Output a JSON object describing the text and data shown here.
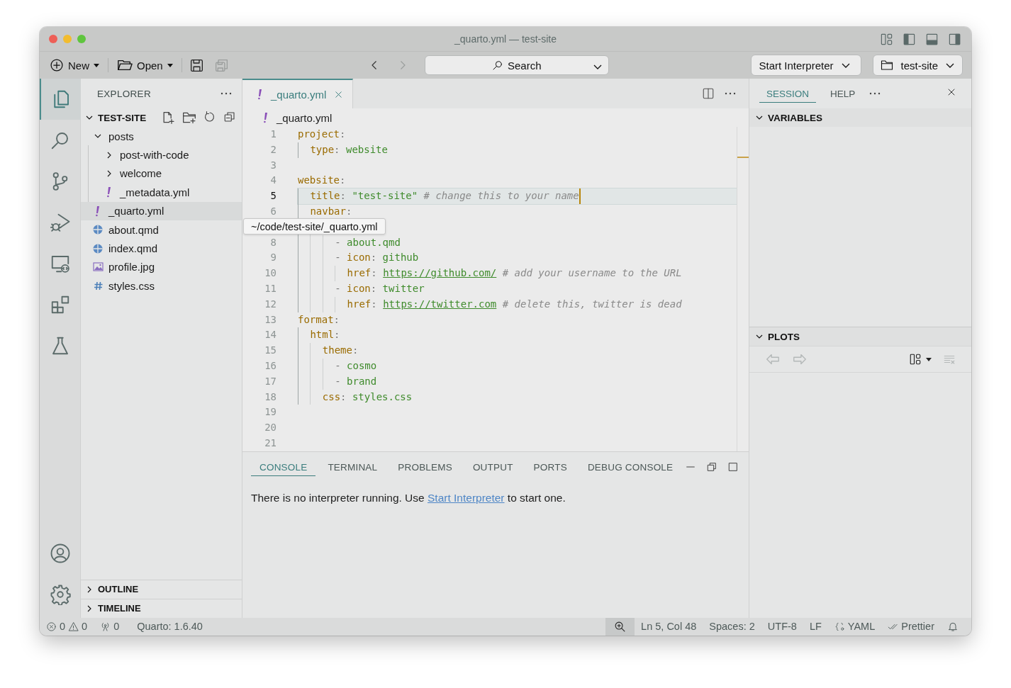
{
  "window": {
    "title": "_quarto.yml — test-site"
  },
  "toolbar": {
    "new": "New",
    "open": "Open",
    "save_all_disabled": true,
    "back_disabled": false,
    "forward_disabled": true,
    "search": {
      "placeholder": "Search"
    },
    "interpreter": "Start Interpreter",
    "folder": "test-site"
  },
  "activity_bar": [
    {
      "kind": "files",
      "selected": true
    },
    {
      "kind": "search",
      "selected": false
    },
    {
      "kind": "scm",
      "selected": false
    },
    {
      "kind": "debug",
      "selected": false
    },
    {
      "kind": "remote",
      "selected": false
    },
    {
      "kind": "extensions",
      "selected": false
    },
    {
      "kind": "flask",
      "selected": false
    }
  ],
  "activity_bottom": [
    {
      "kind": "account"
    },
    {
      "kind": "settings"
    }
  ],
  "explorer": {
    "title": "EXPLORER",
    "root": {
      "label": "TEST-SITE",
      "expanded": true
    },
    "items": [
      {
        "label": "posts",
        "kind": "folder",
        "expanded": true,
        "selected": false,
        "children": [
          {
            "label": "post-with-code",
            "kind": "folder",
            "expanded": false,
            "selected": false
          },
          {
            "label": "welcome",
            "kind": "folder",
            "expanded": false,
            "selected": false
          },
          {
            "label": "_metadata.yml",
            "kind": "yaml",
            "selected": false
          }
        ]
      },
      {
        "label": "_quarto.yml",
        "kind": "yaml",
        "selected": true
      },
      {
        "label": "about.qmd",
        "kind": "quarto",
        "selected": false
      },
      {
        "label": "index.qmd",
        "kind": "quarto",
        "selected": false
      },
      {
        "label": "profile.jpg",
        "kind": "image",
        "selected": false
      },
      {
        "label": "styles.css",
        "kind": "css",
        "selected": false
      }
    ],
    "sections": [
      {
        "label": "OUTLINE",
        "expanded": false
      },
      {
        "label": "TIMELINE",
        "expanded": false
      }
    ]
  },
  "tooltip": "~/code/test-site/_quarto.yml",
  "editor": {
    "tabs": [
      {
        "label": "_quarto.yml",
        "kind": "yaml",
        "selected": true
      }
    ],
    "breadcrumb": "_quarto.yml",
    "lines": [
      {
        "number": "1",
        "current": false,
        "tokens": [
          {
            "kind": "key",
            "text": "project"
          },
          {
            "kind": "punct",
            "text": ":"
          }
        ],
        "children": [
          {
            "number": "2",
            "current": false,
            "tokens": [
              {
                "kind": "key",
                "text": "type"
              },
              {
                "kind": "punct",
                "text": ": "
              },
              {
                "kind": "value",
                "text": "website"
              }
            ]
          }
        ]
      },
      {
        "number": "3",
        "current": false
      },
      {
        "number": "4",
        "current": false,
        "tokens": [
          {
            "kind": "key",
            "text": "website"
          },
          {
            "kind": "punct",
            "text": ":"
          }
        ],
        "children": [
          {
            "number": "5",
            "current": true,
            "tokens": [
              {
                "kind": "key",
                "text": "title"
              },
              {
                "kind": "punct",
                "text": ": "
              },
              {
                "kind": "value",
                "text": "\"test-site\""
              },
              {
                "kind": "comment",
                "text": " # change this to your name"
              }
            ]
          },
          {
            "number": "6",
            "current": false,
            "tokens": [
              {
                "kind": "key",
                "text": "navbar"
              },
              {
                "kind": "punct",
                "text": ":"
              }
            ],
            "children": [
              {
                "current": false,
                "children": [
                  {
                    "number": "8",
                    "current": false,
                    "tokens": [
                      {
                        "kind": "punct",
                        "text": "- "
                      },
                      {
                        "kind": "value",
                        "text": "about.qmd"
                      }
                    ]
                  },
                  {
                    "number": "9",
                    "current": false,
                    "tokens": [
                      {
                        "kind": "punct",
                        "text": "- "
                      },
                      {
                        "kind": "key",
                        "text": "icon"
                      },
                      {
                        "kind": "punct",
                        "text": ": "
                      },
                      {
                        "kind": "value",
                        "text": "github"
                      }
                    ],
                    "children": [
                      {
                        "number": "10",
                        "current": false,
                        "tokens": [
                          {
                            "kind": "key",
                            "text": "href"
                          },
                          {
                            "kind": "punct",
                            "text": ": "
                          },
                          {
                            "kind": "link",
                            "text": "https://github.com/"
                          },
                          {
                            "kind": "comment",
                            "text": " # add your username to the URL"
                          }
                        ]
                      }
                    ]
                  },
                  {
                    "number": "11",
                    "current": false,
                    "tokens": [
                      {
                        "kind": "punct",
                        "text": "- "
                      },
                      {
                        "kind": "key",
                        "text": "icon"
                      },
                      {
                        "kind": "punct",
                        "text": ": "
                      },
                      {
                        "kind": "value",
                        "text": "twitter"
                      }
                    ],
                    "children": [
                      {
                        "number": "12",
                        "current": false,
                        "tokens": [
                          {
                            "kind": "key",
                            "text": "href"
                          },
                          {
                            "kind": "punct",
                            "text": ": "
                          },
                          {
                            "kind": "link",
                            "text": "https://twitter.com"
                          },
                          {
                            "kind": "comment",
                            "text": " # delete this, twitter is dead"
                          }
                        ]
                      }
                    ]
                  }
                ]
              }
            ]
          }
        ]
      },
      {
        "number": "13",
        "current": false,
        "tokens": [
          {
            "kind": "key",
            "text": "format"
          },
          {
            "kind": "punct",
            "text": ":"
          }
        ],
        "children": [
          {
            "number": "14",
            "current": false,
            "tokens": [
              {
                "kind": "key",
                "text": "html"
              },
              {
                "kind": "punct",
                "text": ":"
              }
            ],
            "children": [
              {
                "number": "15",
                "current": false,
                "tokens": [
                  {
                    "kind": "key",
                    "text": "theme"
                  },
                  {
                    "kind": "punct",
                    "text": ":"
                  }
                ],
                "children": [
                  {
                    "number": "16",
                    "current": false,
                    "tokens": [
                      {
                        "kind": "punct",
                        "text": "- "
                      },
                      {
                        "kind": "value",
                        "text": "cosmo"
                      }
                    ]
                  },
                  {
                    "number": "17",
                    "current": false,
                    "tokens": [
                      {
                        "kind": "punct",
                        "text": "- "
                      },
                      {
                        "kind": "value",
                        "text": "brand"
                      }
                    ]
                  }
                ]
              },
              {
                "number": "18",
                "current": false,
                "tokens": [
                  {
                    "kind": "key",
                    "text": "css"
                  },
                  {
                    "kind": "punct",
                    "text": ": "
                  },
                  {
                    "kind": "value",
                    "text": "styles.css"
                  }
                ]
              }
            ]
          }
        ]
      },
      {
        "number": "19",
        "current": false
      },
      {
        "number": "20",
        "current": false
      },
      {
        "number": "21",
        "current": false
      }
    ]
  },
  "panel": {
    "tabs": [
      {
        "label": "CONSOLE",
        "selected": true
      },
      {
        "label": "TERMINAL",
        "selected": false
      },
      {
        "label": "PROBLEMS",
        "selected": false
      },
      {
        "label": "OUTPUT",
        "selected": false
      },
      {
        "label": "PORTS",
        "selected": false
      },
      {
        "label": "DEBUG CONSOLE",
        "selected": false
      }
    ],
    "message": {
      "before": "There is no interpreter running. Use ",
      "link": "Start Interpreter",
      "after": " to start one."
    }
  },
  "session": {
    "tabs": [
      {
        "label": "SESSION",
        "selected": true
      },
      {
        "label": "HELP",
        "selected": false
      }
    ],
    "sections": [
      {
        "label": "VARIABLES",
        "expanded": true
      },
      {
        "label": "PLOTS",
        "expanded": true
      }
    ]
  },
  "status_bar": {
    "errors": "0",
    "warnings": "0",
    "ports": "0",
    "quarto": "Quarto: 1.6.40",
    "position": "Ln 5, Col 48",
    "spaces": "Spaces: 2",
    "encoding": "UTF-8",
    "eol": "LF",
    "language": "YAML",
    "formatter": "Prettier"
  }
}
